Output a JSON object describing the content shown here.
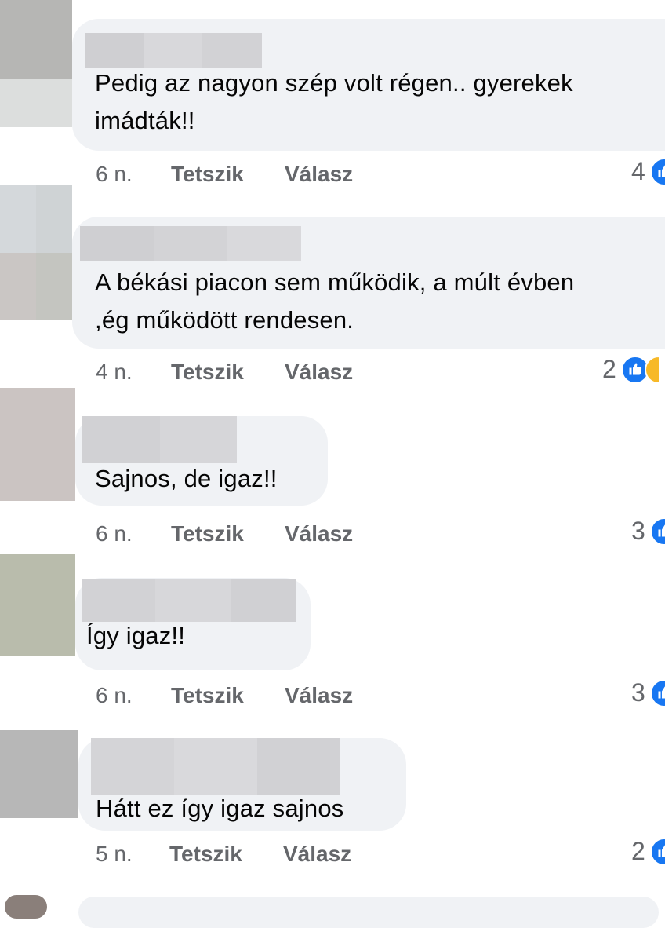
{
  "comments": [
    {
      "text": "Pedig az nagyon szép volt régen.. gyerekek\nimádták!!",
      "age": "6 n.",
      "like_label": "Tetszik",
      "reply_label": "Válasz",
      "reaction_count": "4",
      "reaction_icons": [
        "like-icon"
      ]
    },
    {
      "text": "A békási piacon sem működik, a múlt évben\n,ég működött rendesen.",
      "age": "4 n.",
      "like_label": "Tetszik",
      "reply_label": "Válasz",
      "reaction_count": "2",
      "reaction_icons": [
        "like-icon",
        "haha-icon"
      ]
    },
    {
      "text": "Sajnos, de igaz!!",
      "age": "6 n.",
      "like_label": "Tetszik",
      "reply_label": "Válasz",
      "reaction_count": "3",
      "reaction_icons": [
        "like-icon"
      ]
    },
    {
      "text": "Így igaz!!",
      "age": "6 n.",
      "like_label": "Tetszik",
      "reply_label": "Válasz",
      "reaction_count": "3",
      "reaction_icons": [
        "like-icon"
      ]
    },
    {
      "text": "Hátt ez így igaz sajnos",
      "age": "5 n.",
      "like_label": "Tetszik",
      "reply_label": "Válasz",
      "reaction_count": "2",
      "reaction_icons": [
        "like-icon"
      ]
    }
  ],
  "colors": {
    "bubble": "#f0f2f5",
    "meta_text": "#65676b",
    "like_blue": "#1877f2"
  }
}
